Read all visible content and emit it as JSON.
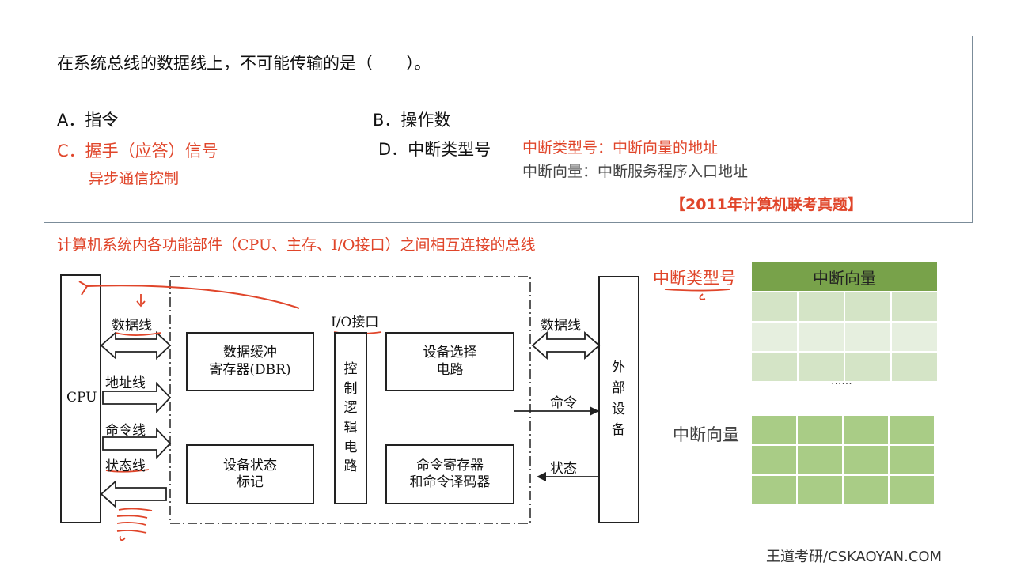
{
  "question": {
    "stem": "在系统总线的数据线上，不可能传输的是（　　）。",
    "option_a": "A．指令",
    "option_b": "B．操作数",
    "option_c": "C．握手（应答）信号",
    "option_c_note": "异步通信控制",
    "option_d": "D．中断类型号",
    "note_line1": "中断类型号：中断向量的地址",
    "note_line2": "中断向量：中断服务程序入口地址",
    "source": "【2011年计算机联考真题】"
  },
  "caption": "计算机系统内各功能部件（CPU、主存、I/O接口）之间相互连接的总线",
  "diagram": {
    "cpu": "CPU",
    "data_line": "数据线",
    "address_line": "地址线",
    "command_line": "命令线",
    "status_line": "状态线",
    "io_interface": "I/O接口",
    "dbr": "数据缓冲\n寄存器(DBR)",
    "control_logic": "控\n制\n逻\n辑\n电\n路",
    "device_select": "设备选择\n电路",
    "device_status": "设备状态\n标记",
    "command_register": "命令寄存器\n和命令译码器",
    "right_data_line": "数据线",
    "command": "命令",
    "status": "状态",
    "external_device": "外\n部\n设\n备"
  },
  "vector_table": {
    "type_label": "中断类型号",
    "header": "中断向量",
    "ellipsis": "......",
    "vector_label": "中断向量"
  },
  "watermark": "王道考研/CSKAOYAN.COM",
  "colors": {
    "accent_red": "#e0452a",
    "table_header": "#78a24a",
    "table_light": "#d4e4c6",
    "table_green": "#a9cc86"
  }
}
